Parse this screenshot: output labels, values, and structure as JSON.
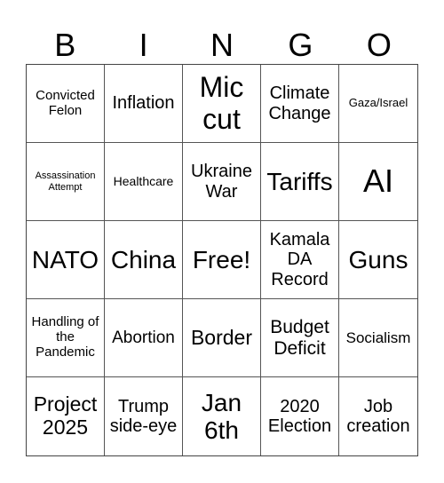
{
  "header": [
    "B",
    "I",
    "N",
    "G",
    "O"
  ],
  "cells": [
    "Convicted Felon",
    "Inflation",
    "Mic cut",
    "Climate Change",
    "Gaza/Israel",
    "Assassination Attempt",
    "Healthcare",
    "Ukraine War",
    "Tariffs",
    "AI",
    "NATO",
    "China",
    "Free!",
    "Kamala DA Record",
    "Guns",
    "Handling of the Pandemic",
    "Abortion",
    "Border",
    "Budget Deficit",
    "Socialism",
    "Project 2025",
    "Trump side-eye",
    "Jan 6th",
    "2020 Election",
    "Job creation"
  ]
}
